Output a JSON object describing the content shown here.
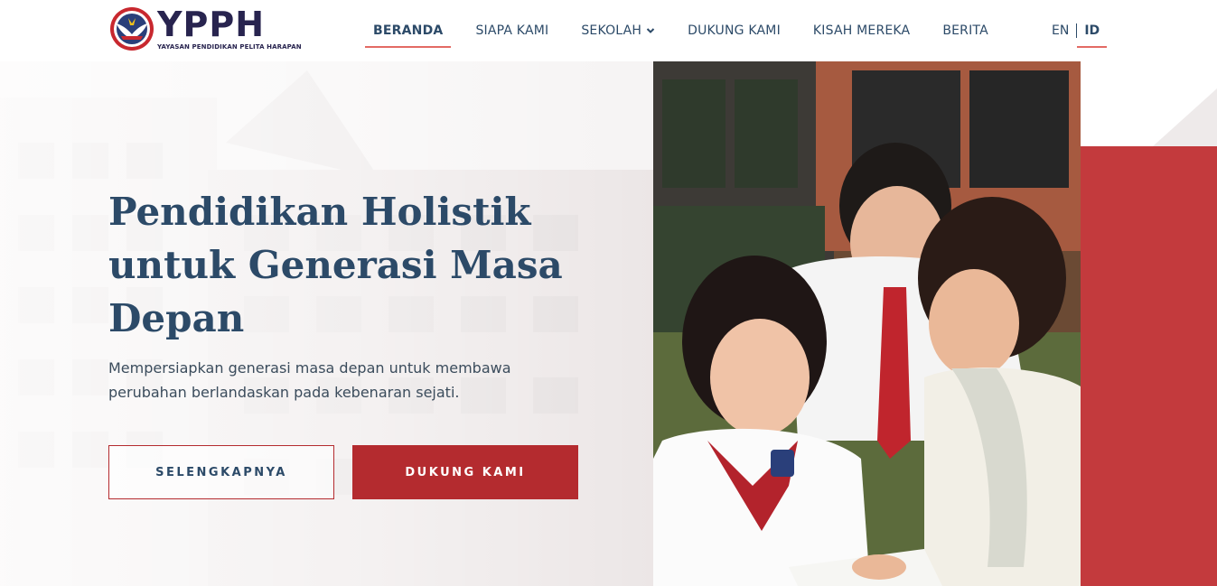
{
  "brand": {
    "wordmark": "YPPH",
    "tagline": "YAYASAN PENDIDIKAN PELITA HARAPAN",
    "colors": {
      "navy": "#2c4a68",
      "red": "#b42b2f",
      "accent": "#e36a64",
      "panel_red": "#c33a3d"
    }
  },
  "nav": {
    "items": [
      {
        "label": "BERANDA",
        "active": true
      },
      {
        "label": "SIAPA KAMI",
        "active": false
      },
      {
        "label": "SEKOLAH",
        "active": false,
        "has_dropdown": true
      },
      {
        "label": "DUKUNG KAMI",
        "active": false
      },
      {
        "label": "KISAH MEREKA",
        "active": false
      },
      {
        "label": "BERITA",
        "active": false
      }
    ]
  },
  "lang": {
    "options": [
      {
        "label": "EN",
        "active": false
      },
      {
        "label": "ID",
        "active": true
      }
    ]
  },
  "hero": {
    "title": "Pendidikan Holistik untuk Generasi Masa Depan",
    "subtitle": "Mempersiapkan generasi masa depan untuk membawa perubahan berlandaskan pada kebenaran sejati.",
    "primary_button": "SELENGKAPNYA",
    "secondary_button": "DUKUNG KAMI"
  },
  "icons": {
    "logo": "ypph-eagle-emblem-icon",
    "dropdown": "chevron-down-icon"
  }
}
